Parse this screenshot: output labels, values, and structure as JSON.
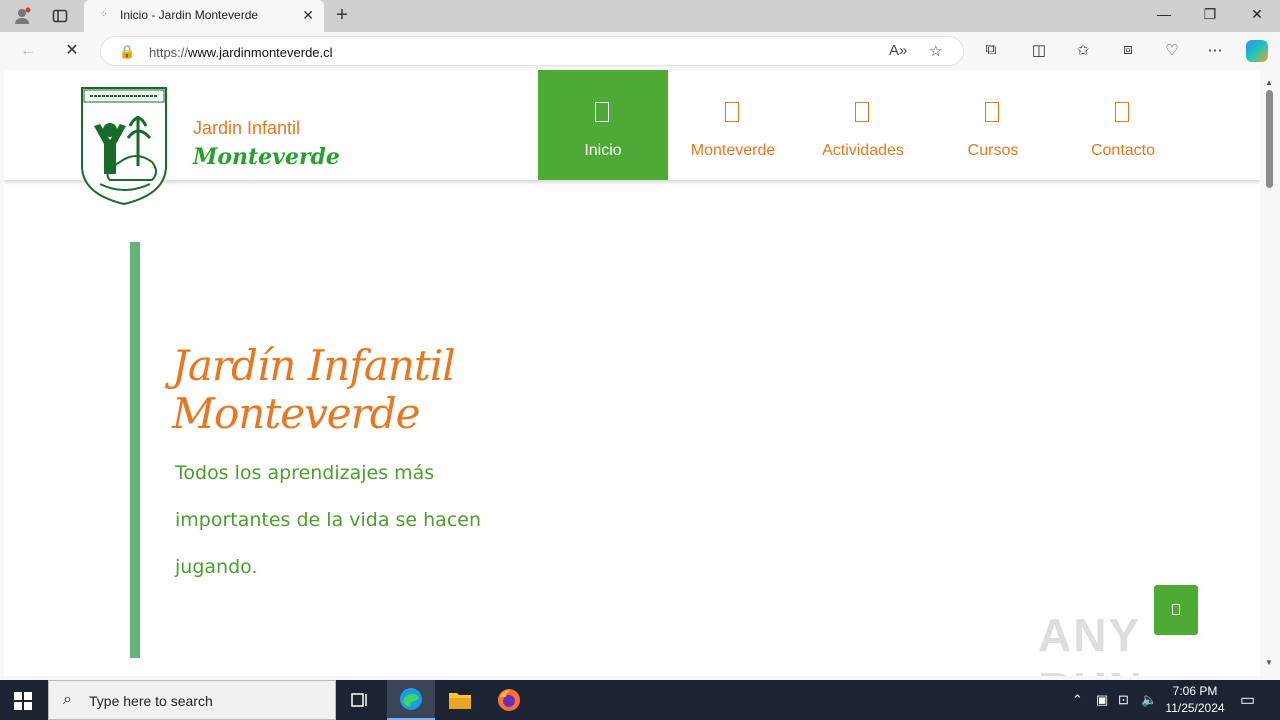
{
  "browser": {
    "tab_title": "Inicio - Jardin Monteverde",
    "url_prefix": "https://",
    "url_host": "www.jardinmonteverde.cl"
  },
  "site": {
    "brand_line1": "Jardin Infantil",
    "brand_line2": "Monteverde",
    "logo_text": "JARDIN INFANTIL MONTEVERDE",
    "menu": [
      {
        "label": "Inicio",
        "active": true
      },
      {
        "label": "Monteverde",
        "active": false
      },
      {
        "label": "Actividades",
        "active": false
      },
      {
        "label": "Cursos",
        "active": false
      },
      {
        "label": "Contacto",
        "active": false
      }
    ],
    "hero_title_line1": "Jardín Infantil",
    "hero_title_line2": "Monteverde",
    "hero_text": "Todos los aprendizajes más importantes de la vida se hacen jugando.",
    "colors": {
      "orange": "#e87722",
      "green": "#4caa35",
      "bar": "#63b37a"
    }
  },
  "watermark": "ANY RUN",
  "taskbar": {
    "search_placeholder": "Type here to search",
    "time": "7:06 PM",
    "date": "11/25/2024"
  }
}
